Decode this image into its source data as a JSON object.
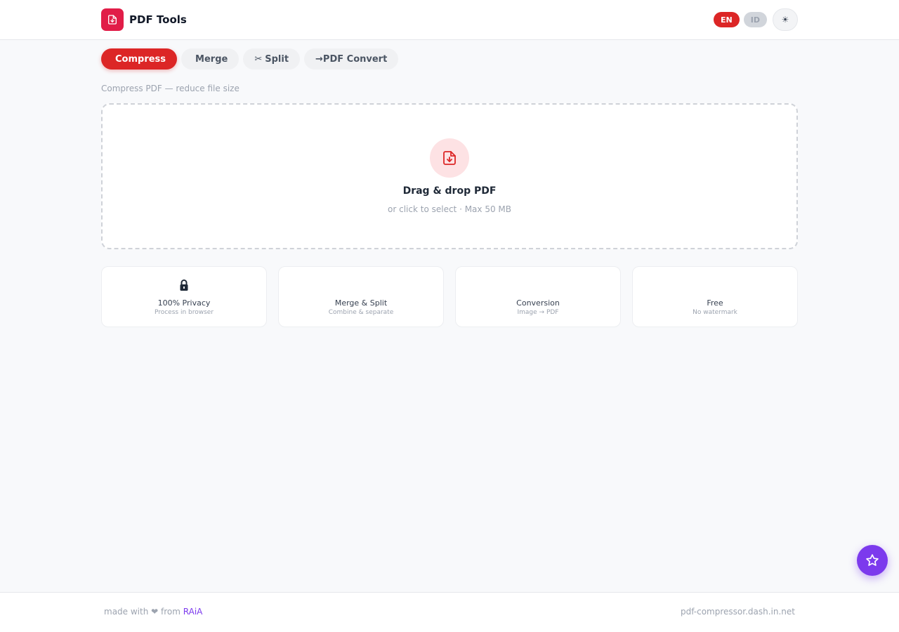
{
  "header": {
    "title": "PDF Tools",
    "logo_icon": "pdf-file-icon",
    "languages": [
      "EN",
      "ID"
    ],
    "active_language": "EN",
    "theme_toggle_glyph": "☀",
    "theme_icon": "sun-icon"
  },
  "tabs": [
    {
      "label": "Compress",
      "glyph": "",
      "icon": "compress-icon",
      "active": true
    },
    {
      "label": "Merge",
      "glyph": "",
      "icon": "merge-icon",
      "active": false
    },
    {
      "label": "Split",
      "glyph": "✂",
      "icon": "scissors-icon",
      "active": false
    },
    {
      "label": "→PDF Convert",
      "glyph": "",
      "icon": "convert-icon",
      "active": false
    }
  ],
  "subtitle": "Compress PDF — reduce file size",
  "dropzone": {
    "title": "Drag & drop PDF",
    "subtitle": "or click to select · Max 50 MB",
    "icon": "pdf-download-icon"
  },
  "features": [
    {
      "title": "100% Privacy",
      "subtitle": "Process in browser",
      "glyph": "🔒",
      "icon": "lock-icon"
    },
    {
      "title": "Merge & Split",
      "subtitle": "Combine & separate",
      "glyph": "",
      "icon": "merge-split-icon"
    },
    {
      "title": "Conversion",
      "subtitle": "Image → PDF",
      "glyph": "",
      "icon": "conversion-icon"
    },
    {
      "title": "Free",
      "subtitle": "No watermark",
      "glyph": "",
      "icon": "free-icon"
    }
  ],
  "footer": {
    "made_with": "made with ❤ from",
    "brand": "RAiA",
    "domain": "pdf-compressor.dash.in.net"
  },
  "fab_icon": "star-icon",
  "colors": {
    "accent": "#dc2626",
    "logo": "#e11d48",
    "fab": "#7c3aed",
    "background": "#f8f9fb"
  }
}
